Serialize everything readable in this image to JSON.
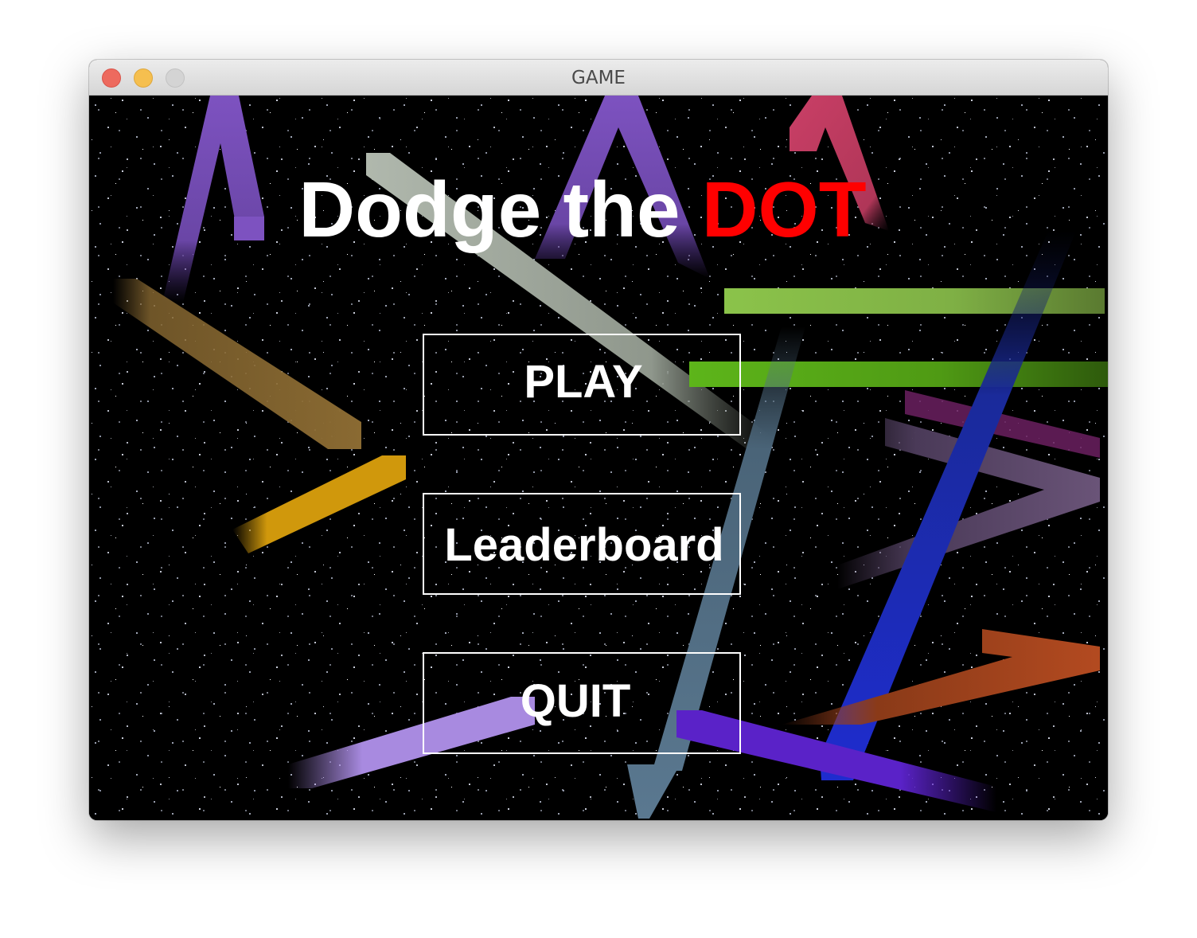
{
  "window": {
    "title": "GAME"
  },
  "game": {
    "title_part1": "Dodge the ",
    "title_part2": "DOT",
    "title_color": "#ffffff",
    "accent_color": "#ff0000",
    "background_color": "#000000"
  },
  "menu": {
    "play_label": "PLAY",
    "leaderboard_label": "Leaderboard",
    "quit_label": "QUIT"
  },
  "streak_colors": [
    "#7d52c0",
    "#c93f66",
    "#b0b8ad",
    "#8a6a32",
    "#d0980c",
    "#8bc34a",
    "#5db51a",
    "#5a7890",
    "#1e2ccf",
    "#6b2060",
    "#5e4a6e",
    "#b34a20",
    "#a88ae0",
    "#5a22c8"
  ]
}
